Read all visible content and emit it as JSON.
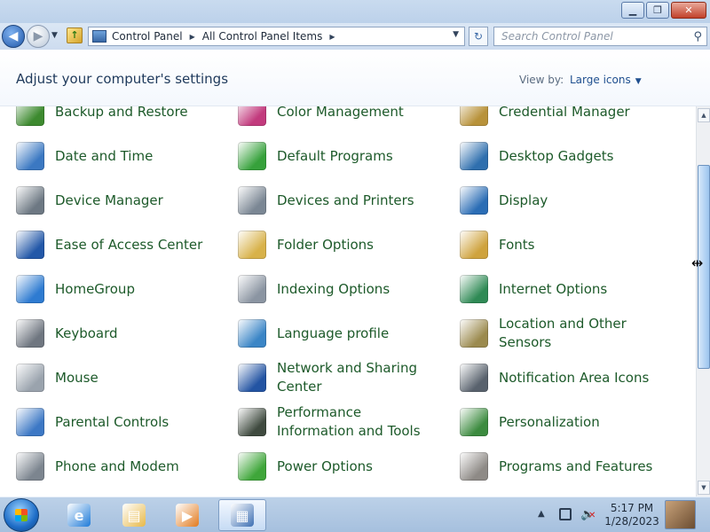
{
  "window": {
    "minimize_icon": "minimize-icon",
    "maximize_icon": "restore-icon",
    "close_icon": "close-icon"
  },
  "navigation": {
    "breadcrumb": [
      "Control Panel",
      "All Control Panel Items"
    ],
    "search_placeholder": "Search Control Panel"
  },
  "header": {
    "title": "Adjust your computer's settings",
    "view_by_label": "View by:",
    "view_by_value": "Large icons"
  },
  "items": [
    {
      "label": "Backup and Restore",
      "icon": "backup-restore-icon",
      "color": "#3d8a2f"
    },
    {
      "label": "Color Management",
      "icon": "color-management-icon",
      "color": "#c23a7d"
    },
    {
      "label": "Credential Manager",
      "icon": "credential-manager-icon",
      "color": "#b8923a"
    },
    {
      "label": "Date and Time",
      "icon": "date-time-icon",
      "color": "#3b78c2"
    },
    {
      "label": "Default Programs",
      "icon": "default-programs-icon",
      "color": "#36a13b"
    },
    {
      "label": "Desktop Gadgets",
      "icon": "desktop-gadgets-icon",
      "color": "#2f6fae"
    },
    {
      "label": "Device Manager",
      "icon": "device-manager-icon",
      "color": "#6d7883"
    },
    {
      "label": "Devices and Printers",
      "icon": "devices-printers-icon",
      "color": "#7b8794"
    },
    {
      "label": "Display",
      "icon": "display-icon",
      "color": "#2b6db5"
    },
    {
      "label": "Ease of Access Center",
      "icon": "ease-of-access-icon",
      "color": "#2358a8"
    },
    {
      "label": "Folder Options",
      "icon": "folder-options-icon",
      "color": "#d8b24a"
    },
    {
      "label": "Fonts",
      "icon": "fonts-icon",
      "color": "#cfa33e"
    },
    {
      "label": "HomeGroup",
      "icon": "homegroup-icon",
      "color": "#2e7bd1"
    },
    {
      "label": "Indexing Options",
      "icon": "indexing-options-icon",
      "color": "#8b95a2"
    },
    {
      "label": "Internet Options",
      "icon": "internet-options-icon",
      "color": "#2f8a55"
    },
    {
      "label": "Keyboard",
      "icon": "keyboard-icon",
      "color": "#6f7680"
    },
    {
      "label": "Language profile",
      "icon": "language-profile-icon",
      "color": "#3a85c6"
    },
    {
      "label": "Location and Other Sensors",
      "icon": "location-sensors-icon",
      "color": "#9b8a4e"
    },
    {
      "label": "Mouse",
      "icon": "mouse-icon",
      "color": "#9aa3ad"
    },
    {
      "label": "Network and Sharing Center",
      "icon": "network-sharing-icon",
      "color": "#2354a3"
    },
    {
      "label": "Notification Area Icons",
      "icon": "notification-area-icon",
      "color": "#59626d"
    },
    {
      "label": "Parental Controls",
      "icon": "parental-controls-icon",
      "color": "#3d78c5"
    },
    {
      "label": "Performance Information and Tools",
      "icon": "performance-icon",
      "color": "#3f4a3f"
    },
    {
      "label": "Personalization",
      "icon": "personalization-icon",
      "color": "#3c8b3f"
    },
    {
      "label": "Phone and Modem",
      "icon": "phone-modem-icon",
      "color": "#7c858f"
    },
    {
      "label": "Power Options",
      "icon": "power-options-icon",
      "color": "#3fa63a"
    },
    {
      "label": "Programs and Features",
      "icon": "programs-features-icon",
      "color": "#8e8a86"
    }
  ],
  "taskbar": {
    "buttons": [
      {
        "icon": "internet-explorer-icon",
        "glyph": "e",
        "color": "#1d7ad8"
      },
      {
        "icon": "windows-explorer-icon",
        "glyph": "▤",
        "color": "#e7b847"
      },
      {
        "icon": "media-player-icon",
        "glyph": "▶",
        "color": "#e27a1e"
      },
      {
        "icon": "control-panel-icon",
        "glyph": "▦",
        "color": "#3d6fb3"
      }
    ],
    "time": "5:17 PM",
    "date": "1/28/2023"
  }
}
